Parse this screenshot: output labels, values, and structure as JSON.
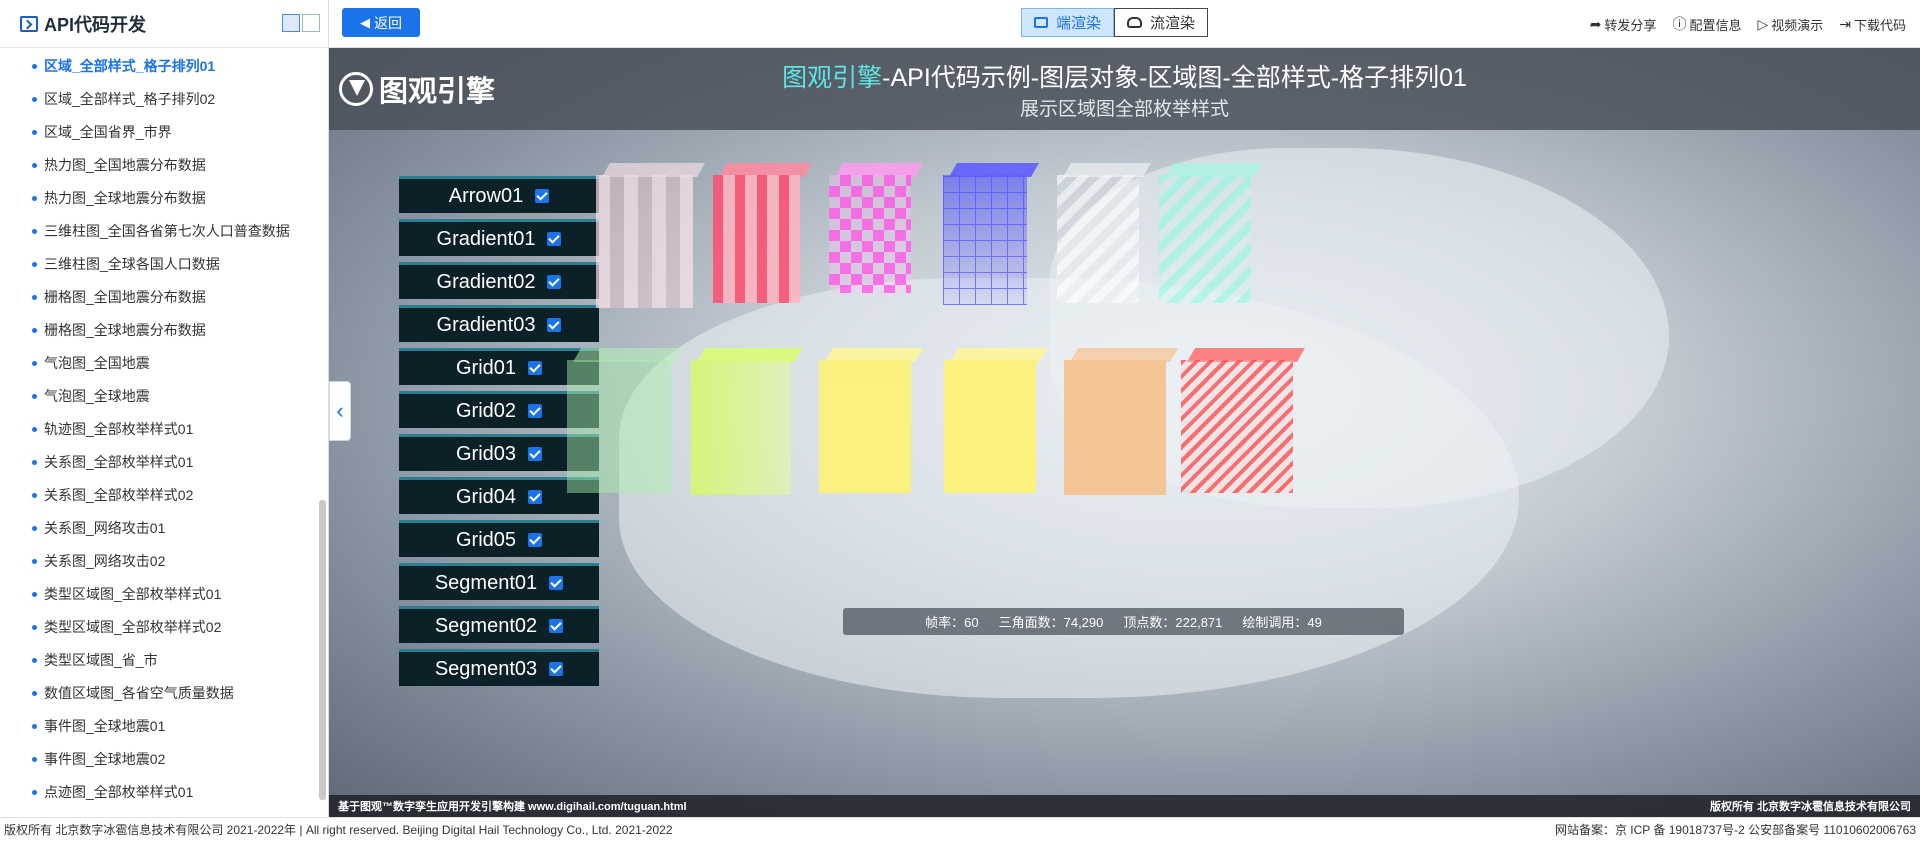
{
  "sidebar": {
    "title": "API代码开发",
    "items": [
      {
        "label": "区域_全部样式_格子排列01",
        "active": true
      },
      {
        "label": "区域_全部样式_格子排列02"
      },
      {
        "label": "区域_全国省界_市界"
      },
      {
        "label": "热力图_全国地震分布数据"
      },
      {
        "label": "热力图_全球地震分布数据"
      },
      {
        "label": "三维柱图_全国各省第七次人口普查数据"
      },
      {
        "label": "三维柱图_全球各国人口数据"
      },
      {
        "label": "栅格图_全国地震分布数据"
      },
      {
        "label": "栅格图_全球地震分布数据"
      },
      {
        "label": "气泡图_全国地震"
      },
      {
        "label": "气泡图_全球地震"
      },
      {
        "label": "轨迹图_全部枚举样式01"
      },
      {
        "label": "关系图_全部枚举样式01"
      },
      {
        "label": "关系图_全部枚举样式02"
      },
      {
        "label": "关系图_网络攻击01"
      },
      {
        "label": "关系图_网络攻击02"
      },
      {
        "label": "类型区域图_全部枚举样式01"
      },
      {
        "label": "类型区域图_全部枚举样式02"
      },
      {
        "label": "类型区域图_省_市"
      },
      {
        "label": "数值区域图_各省空气质量数据"
      },
      {
        "label": "事件图_全球地震01"
      },
      {
        "label": "事件图_全球地震02"
      },
      {
        "label": "点迹图_全部枚举样式01"
      }
    ]
  },
  "topbar": {
    "back_label": "返回",
    "render_client": "端渲染",
    "render_stream": "流渲染",
    "actions": [
      {
        "icon": "share-icon",
        "label": "转发分享"
      },
      {
        "icon": "info-icon",
        "label": "配置信息"
      },
      {
        "icon": "play-icon",
        "label": "视频演示"
      },
      {
        "icon": "download-icon",
        "label": "下载代码"
      }
    ]
  },
  "viewer": {
    "logo_text": "图观引擎",
    "title_brand": "图观引擎",
    "title_rest": "-API代码示例-图层对象-区域图-全部样式-格子排列01",
    "subtitle": "展示区域图全部枚举样式",
    "layers": [
      {
        "label": "Arrow01",
        "checked": true
      },
      {
        "label": "Gradient01",
        "checked": true
      },
      {
        "label": "Gradient02",
        "checked": true
      },
      {
        "label": "Gradient03",
        "checked": true
      },
      {
        "label": "Grid01",
        "checked": true
      },
      {
        "label": "Grid02",
        "checked": true
      },
      {
        "label": "Grid03",
        "checked": true
      },
      {
        "label": "Grid04",
        "checked": true
      },
      {
        "label": "Grid05",
        "checked": true
      },
      {
        "label": "Segment01",
        "checked": true
      },
      {
        "label": "Segment02",
        "checked": true
      },
      {
        "label": "Segment03",
        "checked": true
      }
    ],
    "stats": {
      "fps_label": "帧率：",
      "fps": "60",
      "tri_label": "三角面数：",
      "tri": "74,290",
      "vert_label": "顶点数：",
      "vert": "222,871",
      "draw_label": "绘制调用：",
      "draw": "49"
    },
    "footer_left": "基于图观™数字孪生应用开发引擎构建 www.digihail.com/tuguan.html",
    "footer_right": "版权所有 北京数字冰雹信息技术有限公司"
  },
  "bottom": {
    "left": "版权所有 北京数字冰雹信息技术有限公司 2021-2022年 | All right reserved. Beijing Digital Hail Technology Co., Ltd. 2021-2022",
    "right": "网站备案：京 ICP 备 19018737号-2 公安部备案号 11010602006763"
  }
}
